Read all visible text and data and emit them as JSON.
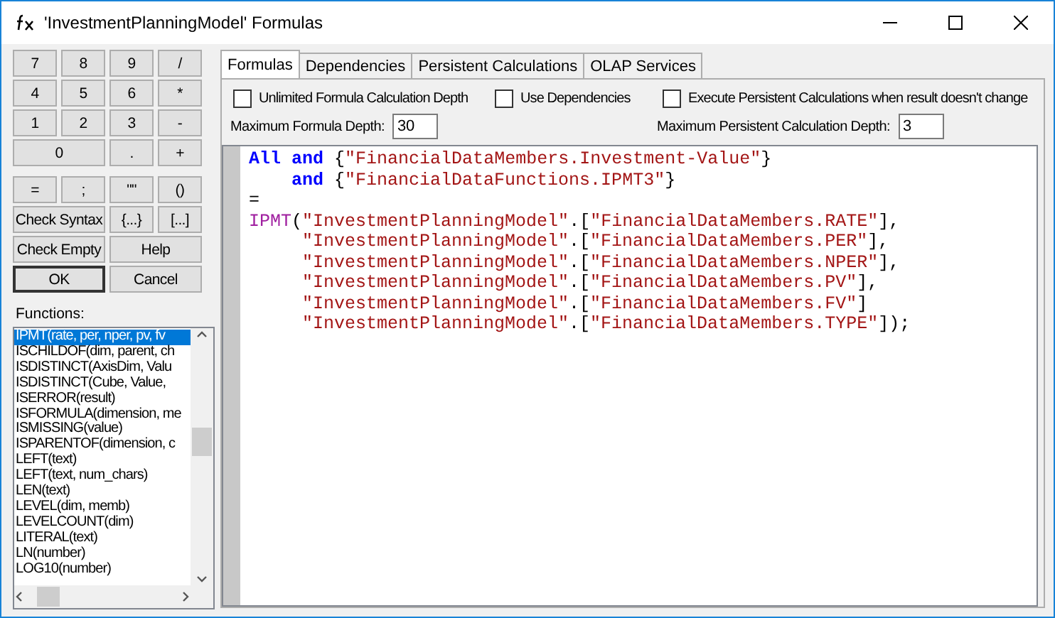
{
  "window": {
    "title": "'InvestmentPlanningModel' Formulas"
  },
  "keypad": [
    {
      "label": "7",
      "wide": false,
      "default": false
    },
    {
      "label": "8",
      "wide": false,
      "default": false
    },
    {
      "label": "9",
      "wide": false,
      "default": false
    },
    {
      "label": "/",
      "wide": false,
      "default": false
    },
    {
      "label": "4",
      "wide": false,
      "default": false
    },
    {
      "label": "5",
      "wide": false,
      "default": false
    },
    {
      "label": "6",
      "wide": false,
      "default": false
    },
    {
      "label": "*",
      "wide": false,
      "default": false
    },
    {
      "label": "1",
      "wide": false,
      "default": false
    },
    {
      "label": "2",
      "wide": false,
      "default": false
    },
    {
      "label": "3",
      "wide": false,
      "default": false
    },
    {
      "label": "-",
      "wide": false,
      "default": false
    },
    {
      "label": "0",
      "wide": true,
      "default": false
    },
    {
      "label": ".",
      "wide": false,
      "default": false
    },
    {
      "label": "+",
      "wide": false,
      "default": false
    }
  ],
  "keypad2": [
    {
      "label": "=",
      "wide": false,
      "default": false
    },
    {
      "label": ";",
      "wide": false,
      "default": false
    },
    {
      "label": "\"\"",
      "wide": false,
      "default": false
    },
    {
      "label": "()",
      "wide": false,
      "default": false
    },
    {
      "label": "Check Syntax",
      "wide": true,
      "default": false
    },
    {
      "label": "{...}",
      "wide": false,
      "default": false
    },
    {
      "label": "[...]",
      "wide": false,
      "default": false
    },
    {
      "label": "Check Empty",
      "wide": true,
      "default": false
    },
    {
      "label": "Help",
      "wide": true,
      "default": false
    },
    {
      "label": "OK",
      "wide": true,
      "default": true
    },
    {
      "label": "Cancel",
      "wide": true,
      "default": false
    }
  ],
  "functions": {
    "label": "Functions:",
    "items": [
      {
        "name": "IPMT(rate, per, nper, pv, fv",
        "selected": true
      },
      {
        "name": "ISCHILDOF(dim, parent, ch",
        "selected": false
      },
      {
        "name": "ISDISTINCT(AxisDim, Valu",
        "selected": false
      },
      {
        "name": "ISDISTINCT(Cube, Value,",
        "selected": false
      },
      {
        "name": "ISERROR(result)",
        "selected": false
      },
      {
        "name": "ISFORMULA(dimension, me",
        "selected": false
      },
      {
        "name": "ISMISSING(value)",
        "selected": false
      },
      {
        "name": "ISPARENTOF(dimension, c",
        "selected": false
      },
      {
        "name": "LEFT(text)",
        "selected": false
      },
      {
        "name": "LEFT(text, num_chars)",
        "selected": false
      },
      {
        "name": "LEN(text)",
        "selected": false
      },
      {
        "name": "LEVEL(dim, memb)",
        "selected": false
      },
      {
        "name": "LEVELCOUNT(dim)",
        "selected": false
      },
      {
        "name": "LITERAL(text)",
        "selected": false
      },
      {
        "name": "LN(number)",
        "selected": false
      },
      {
        "name": "LOG10(number)",
        "selected": false
      }
    ]
  },
  "tabs": [
    {
      "label": "Formulas",
      "selected": true
    },
    {
      "label": "Dependencies",
      "selected": false
    },
    {
      "label": "Persistent Calculations",
      "selected": false
    },
    {
      "label": "OLAP Services",
      "selected": false
    }
  ],
  "options": [
    {
      "label": "Unlimited Formula Calculation Depth",
      "checked": false
    },
    {
      "label": "Use Dependencies",
      "checked": false
    },
    {
      "label": "Execute Persistent Calculations when result doesn't change",
      "checked": false
    }
  ],
  "depth_fields": [
    {
      "label": "Maximum Formula Depth:",
      "value": "30"
    },
    {
      "label": "Maximum Persistent Calculation Depth:",
      "value": "3"
    }
  ],
  "editor": {
    "lines": [
      {
        "kind": "head",
        "tokens": [
          {
            "kind": "keyword",
            "text": "All"
          },
          {
            "kind": "keyword",
            "text": "and"
          },
          {
            "kind": "plain",
            "text": "{"
          },
          {
            "kind": "string",
            "text": "\"FinancialDataMembers.Investment-Value\""
          },
          {
            "kind": "plain",
            "text": "}"
          }
        ]
      },
      {
        "kind": "clause",
        "tokens": [
          {
            "kind": "keyword",
            "text": "and"
          },
          {
            "kind": "plain",
            "text": "{"
          },
          {
            "kind": "string",
            "text": "\"FinancialDataFunctions.IPMT3\""
          },
          {
            "kind": "plain",
            "text": "}"
          }
        ]
      },
      {
        "kind": "head",
        "tokens": [
          {
            "kind": "plain",
            "text": "="
          }
        ]
      },
      {
        "kind": "head",
        "tokens": [
          {
            "kind": "function",
            "text": "IPMT"
          },
          {
            "kind": "plain",
            "text": "("
          },
          {
            "kind": "string",
            "text": "\"InvestmentPlanningModel\""
          },
          {
            "kind": "plain",
            "text": ".["
          },
          {
            "kind": "string",
            "text": "\"FinancialDataMembers.RATE\""
          },
          {
            "kind": "plain",
            "text": "],"
          }
        ]
      },
      {
        "kind": "argument",
        "tokens": [
          {
            "kind": "string",
            "text": "\"InvestmentPlanningModel\""
          },
          {
            "kind": "plain",
            "text": ".["
          },
          {
            "kind": "string",
            "text": "\"FinancialDataMembers.PER\""
          },
          {
            "kind": "plain",
            "text": "],"
          }
        ]
      },
      {
        "kind": "argument",
        "tokens": [
          {
            "kind": "string",
            "text": "\"InvestmentPlanningModel\""
          },
          {
            "kind": "plain",
            "text": ".["
          },
          {
            "kind": "string",
            "text": "\"FinancialDataMembers.NPER\""
          },
          {
            "kind": "plain",
            "text": "],"
          }
        ]
      },
      {
        "kind": "argument",
        "tokens": [
          {
            "kind": "string",
            "text": "\"InvestmentPlanningModel\""
          },
          {
            "kind": "plain",
            "text": ".["
          },
          {
            "kind": "string",
            "text": "\"FinancialDataMembers.PV\""
          },
          {
            "kind": "plain",
            "text": "],"
          }
        ]
      },
      {
        "kind": "argument",
        "tokens": [
          {
            "kind": "string",
            "text": "\"InvestmentPlanningModel\""
          },
          {
            "kind": "plain",
            "text": ".["
          },
          {
            "kind": "string",
            "text": "\"FinancialDataMembers.FV\""
          },
          {
            "kind": "plain",
            "text": "]"
          }
        ]
      },
      {
        "kind": "argument",
        "tokens": [
          {
            "kind": "string",
            "text": "\"InvestmentPlanningModel\""
          },
          {
            "kind": "plain",
            "text": ".["
          },
          {
            "kind": "string",
            "text": "\"FinancialDataMembers.TYPE\""
          },
          {
            "kind": "plain",
            "text": "]);"
          }
        ]
      }
    ]
  }
}
